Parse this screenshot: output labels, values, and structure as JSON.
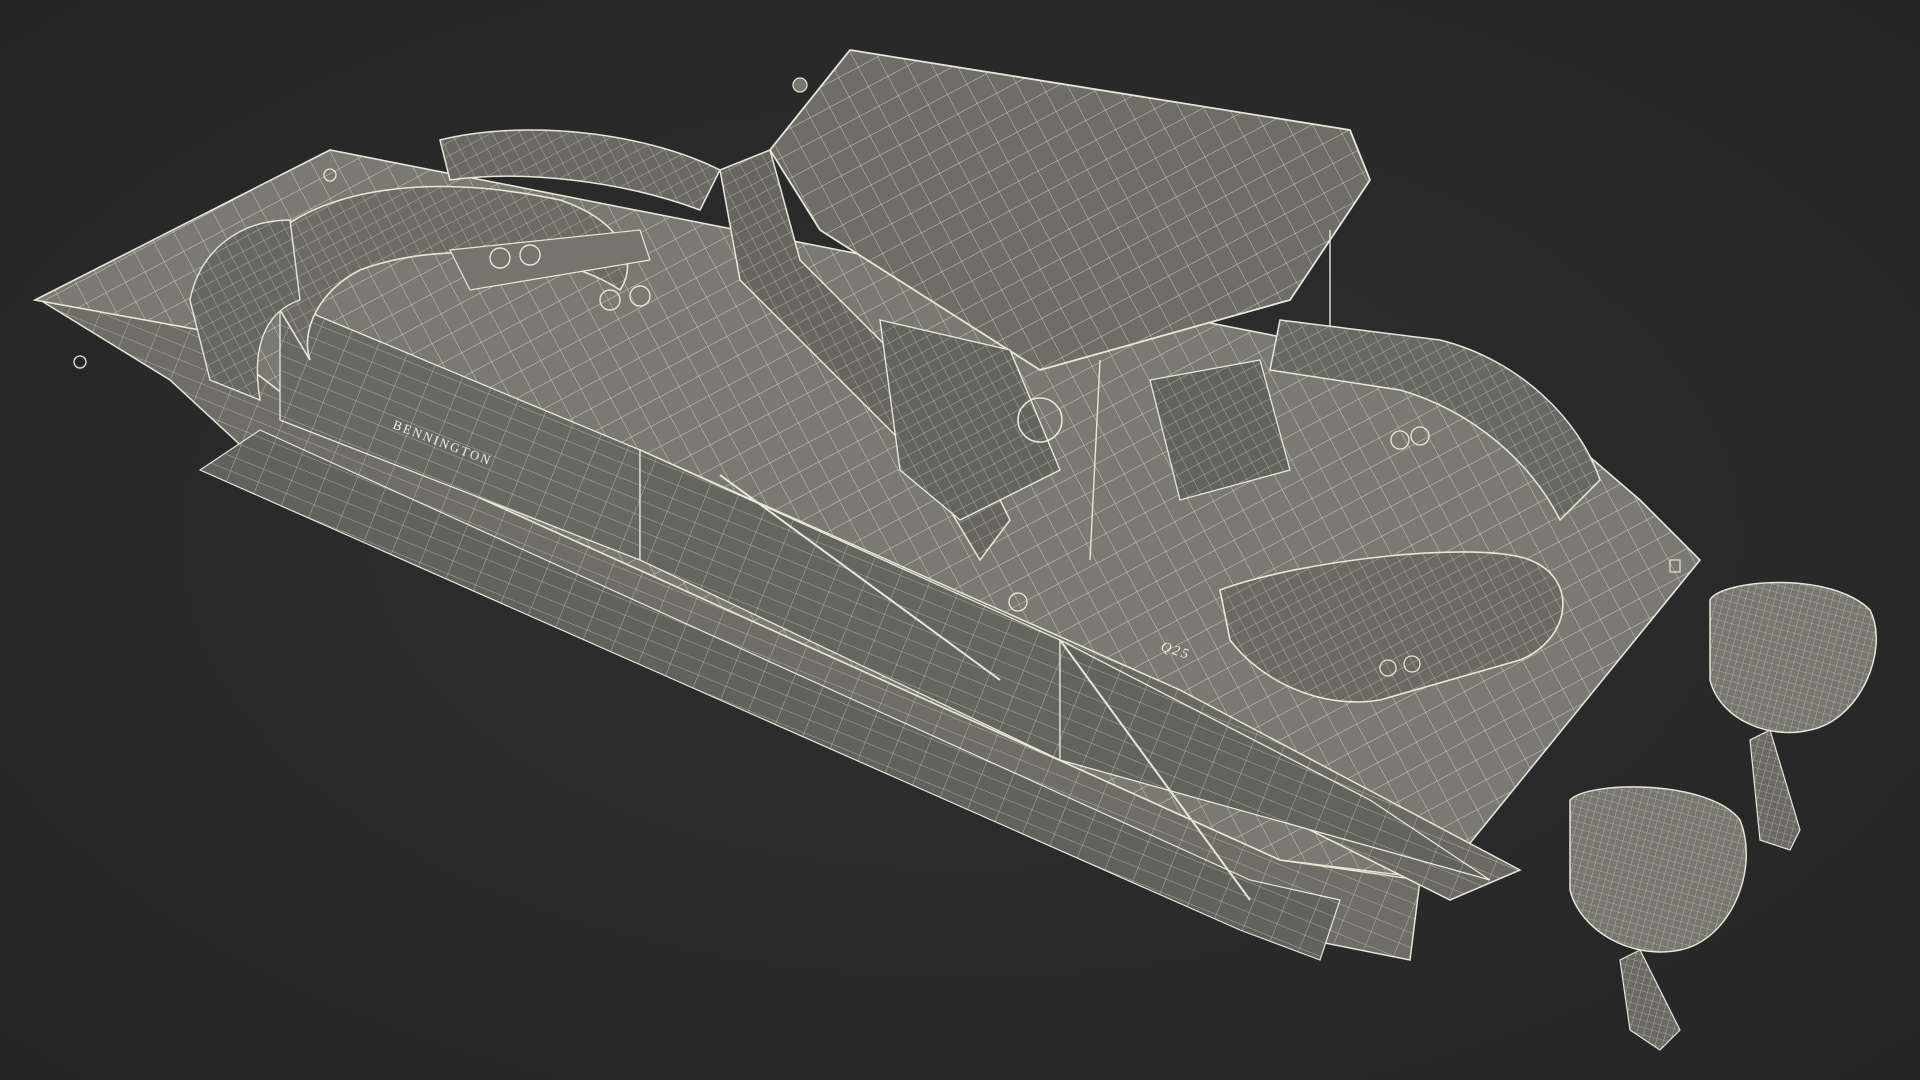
{
  "scene": {
    "subject": "pontoon-boat-wireframe",
    "background_color": "#2a2a2a",
    "surface_color": "#7a7a72",
    "surface_dark": "#5a5a54",
    "wire_color": "#e8e6d8"
  },
  "labels": {
    "brand": "BENNINGTON",
    "model": "Q25"
  }
}
